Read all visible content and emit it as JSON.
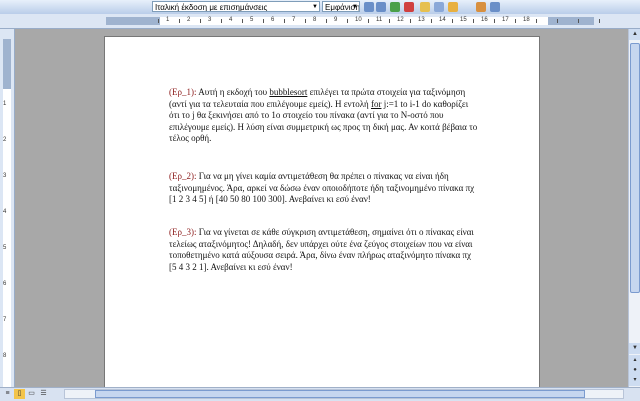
{
  "toolbar": {
    "style_box": "Ιταλική έκδοση με επισημάνσεις",
    "view_box": "Εμφάνιση",
    "colors": {
      "bg": "#c7d7ee"
    }
  },
  "ruler_numbers": [
    "1",
    "2",
    "3",
    "4",
    "5",
    "6",
    "7",
    "8",
    "9",
    "10",
    "11",
    "12",
    "13",
    "14",
    "15",
    "16",
    "17",
    "18"
  ],
  "vruler_numbers": [
    "1",
    "2",
    "3",
    "4",
    "5",
    "6",
    "7",
    "8"
  ],
  "document": {
    "p1": {
      "tag": "(Ερ_1):",
      "text_a": " Αυτή η εκδοχή του ",
      "bubble": "bubblesort",
      "text_b": " επιλέγει τα πρώτα στοιχεία για ταξινόμηση (αντί για τα τελευταία που επιλέγουμε εμείς). Η εντολή ",
      "for": "for",
      "text_c": " j:=1 to i-1 do καθορίζει ότι το j θα ξεκινήσει από το 1ο στοιχείο του πίνακα (αντί για το Ν-οστό που επιλέγουμε εμείς). Η λύση είναι συμμετρική ως προς τη δική μας. Αν κοιτά βέβαια το τέλος ορθή."
    },
    "p2": {
      "tag": "(Ερ_2):",
      "text": " Για να μη γίνει καμία αντιμετάθεση θα πρέπει ο πίνακας να είναι ήδη ταξινομημένος. Άρα, αρκεί να δώσω έναν οποιοδήποτε ήδη ταξινομημένο πίνακα πχ [1 2 3 4 5] ή [40 50 80 100 300]. Ανεβαίνει κι εσύ έναν!"
    },
    "p3": {
      "tag": "(Ερ_3):",
      "text": " Για να γίνεται σε κάθε σύγκριση αντιμετάθεση, σημαίνει ότι ο πίνακας είναι τελείως αταξινόμητος! Δηλαδή, δεν υπάρχει ούτε ένα ζεύγος στοιχείων που να είναι τοποθετημένο κατά αύξουσα σειρά. Άρα, δίνω έναν πλήρως αταξινόμητο πίνακα πχ [5 4 3 2 1]. Ανεβαίνει κι εσύ έναν!"
    }
  }
}
